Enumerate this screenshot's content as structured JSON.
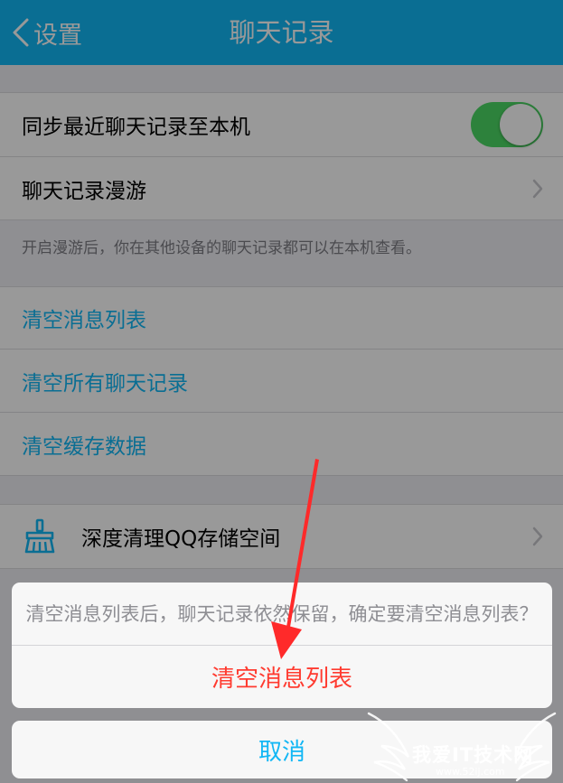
{
  "nav": {
    "back_label": "设置",
    "title": "聊天记录"
  },
  "settings": {
    "sync_label": "同步最近聊天记录至本机",
    "sync_on": true,
    "roaming_label": "聊天记录漫游",
    "roaming_note": "开启漫游后，你在其他设备的聊天记录都可以在本机查看。",
    "clear_list_label": "清空消息列表",
    "clear_all_label": "清空所有聊天记录",
    "clear_cache_label": "清空缓存数据",
    "deep_clean_label": "深度清理QQ存储空间"
  },
  "action_sheet": {
    "message": "清空消息列表后，聊天记录依然保留，确定要清空消息列表？",
    "confirm_label": "清空消息列表",
    "cancel_label": "取消"
  },
  "watermark": {
    "text": "我爱IT技术网",
    "url": "www.52ij.com"
  },
  "colors": {
    "nav_bar": "#12b7f5",
    "accent": "#12b7f5",
    "toggle_on": "#4cd964",
    "destructive": "#ff3b30",
    "annotation_arrow": "#ff2a2a"
  },
  "icons": {
    "back": "chevron-left-icon",
    "disclosure": "chevron-right-icon",
    "deep_clean": "broom-icon"
  }
}
